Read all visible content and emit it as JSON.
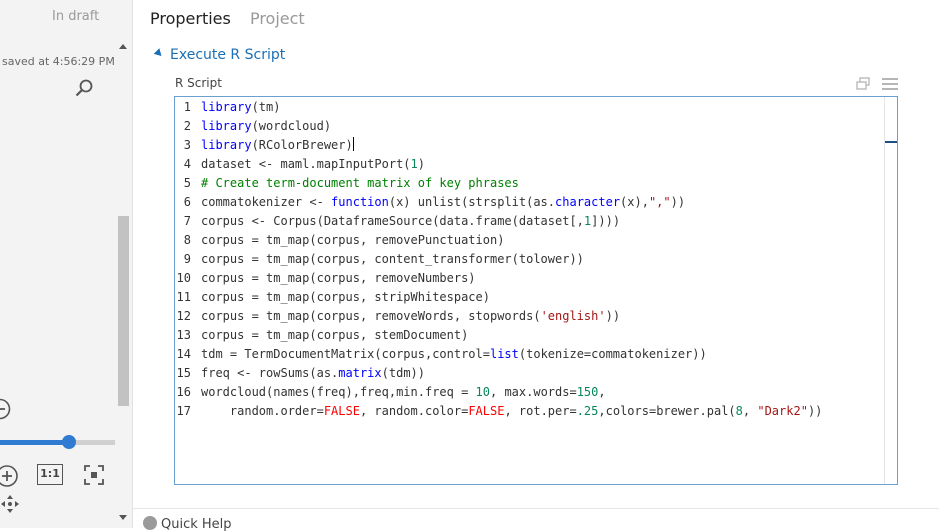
{
  "left_pane": {
    "status": "In draft",
    "saved_text": "saved at 4:56:29 PM",
    "zoom_level": 0.6,
    "one_to_one_label": "1:1"
  },
  "tabs": [
    {
      "label": "Properties",
      "active": true
    },
    {
      "label": "Project",
      "active": false
    }
  ],
  "section": {
    "title": "Execute R Script"
  },
  "field": {
    "label": "R Script"
  },
  "editor": {
    "lines": [
      [
        {
          "t": "library",
          "c": "fn"
        },
        {
          "t": "(tm)"
        }
      ],
      [
        {
          "t": "library",
          "c": "fn"
        },
        {
          "t": "(wordcloud)"
        }
      ],
      [
        {
          "t": "library",
          "c": "fn"
        },
        {
          "t": "(RColorBrewer)"
        },
        {
          "t": "",
          "c": "cursor"
        }
      ],
      [
        {
          "t": "dataset <- maml.mapInputPort("
        },
        {
          "t": "1",
          "c": "num"
        },
        {
          "t": ")"
        }
      ],
      [
        {
          "t": "# Create term-document matrix of key phrases",
          "c": "cm"
        }
      ],
      [
        {
          "t": "commatokenizer <- "
        },
        {
          "t": "function",
          "c": "kw"
        },
        {
          "t": "(x) unlist(strsplit(as."
        },
        {
          "t": "character",
          "c": "fn"
        },
        {
          "t": "(x),"
        },
        {
          "t": "\",\"",
          "c": "str"
        },
        {
          "t": "))"
        }
      ],
      [
        {
          "t": "corpus <- Corpus(DataframeSource(data.frame(dataset[,"
        },
        {
          "t": "1",
          "c": "num"
        },
        {
          "t": "])))"
        }
      ],
      [
        {
          "t": "corpus = tm_map(corpus, removePunctuation)"
        }
      ],
      [
        {
          "t": "corpus = tm_map(corpus, content_transformer(tolower))"
        }
      ],
      [
        {
          "t": "corpus = tm_map(corpus, removeNumbers)"
        }
      ],
      [
        {
          "t": "corpus = tm_map(corpus, stripWhitespace)"
        }
      ],
      [
        {
          "t": "corpus = tm_map(corpus, removeWords, stopwords("
        },
        {
          "t": "'english'",
          "c": "str"
        },
        {
          "t": "))"
        }
      ],
      [
        {
          "t": "corpus = tm_map(corpus, stemDocument)"
        }
      ],
      [
        {
          "t": "tdm = TermDocumentMatrix(corpus,control="
        },
        {
          "t": "list",
          "c": "fn"
        },
        {
          "t": "(tokenize=commatokenizer))"
        }
      ],
      [
        {
          "t": "freq <- rowSums(as."
        },
        {
          "t": "matrix",
          "c": "fn"
        },
        {
          "t": "(tdm))"
        }
      ],
      [
        {
          "t": "wordcloud(names(freq),freq,min.freq = "
        },
        {
          "t": "10",
          "c": "num"
        },
        {
          "t": ", max.words="
        },
        {
          "t": "150",
          "c": "num"
        },
        {
          "t": ","
        }
      ],
      [
        {
          "t": "    random.order="
        },
        {
          "t": "FALSE",
          "c": "lit"
        },
        {
          "t": ", random.color="
        },
        {
          "t": "FALSE",
          "c": "lit"
        },
        {
          "t": ", rot.per="
        },
        {
          "t": ".25",
          "c": "num"
        },
        {
          "t": ",colors=brewer.pal("
        },
        {
          "t": "8",
          "c": "num"
        },
        {
          "t": ", "
        },
        {
          "t": "\"Dark2\"",
          "c": "str"
        },
        {
          "t": "))"
        }
      ]
    ]
  },
  "footer": {
    "quick_help": "Quick Help"
  },
  "colors": {
    "accent": "#1a6fb5",
    "slider": "#2f7bd1",
    "editor_border": "#6aa0cf"
  }
}
